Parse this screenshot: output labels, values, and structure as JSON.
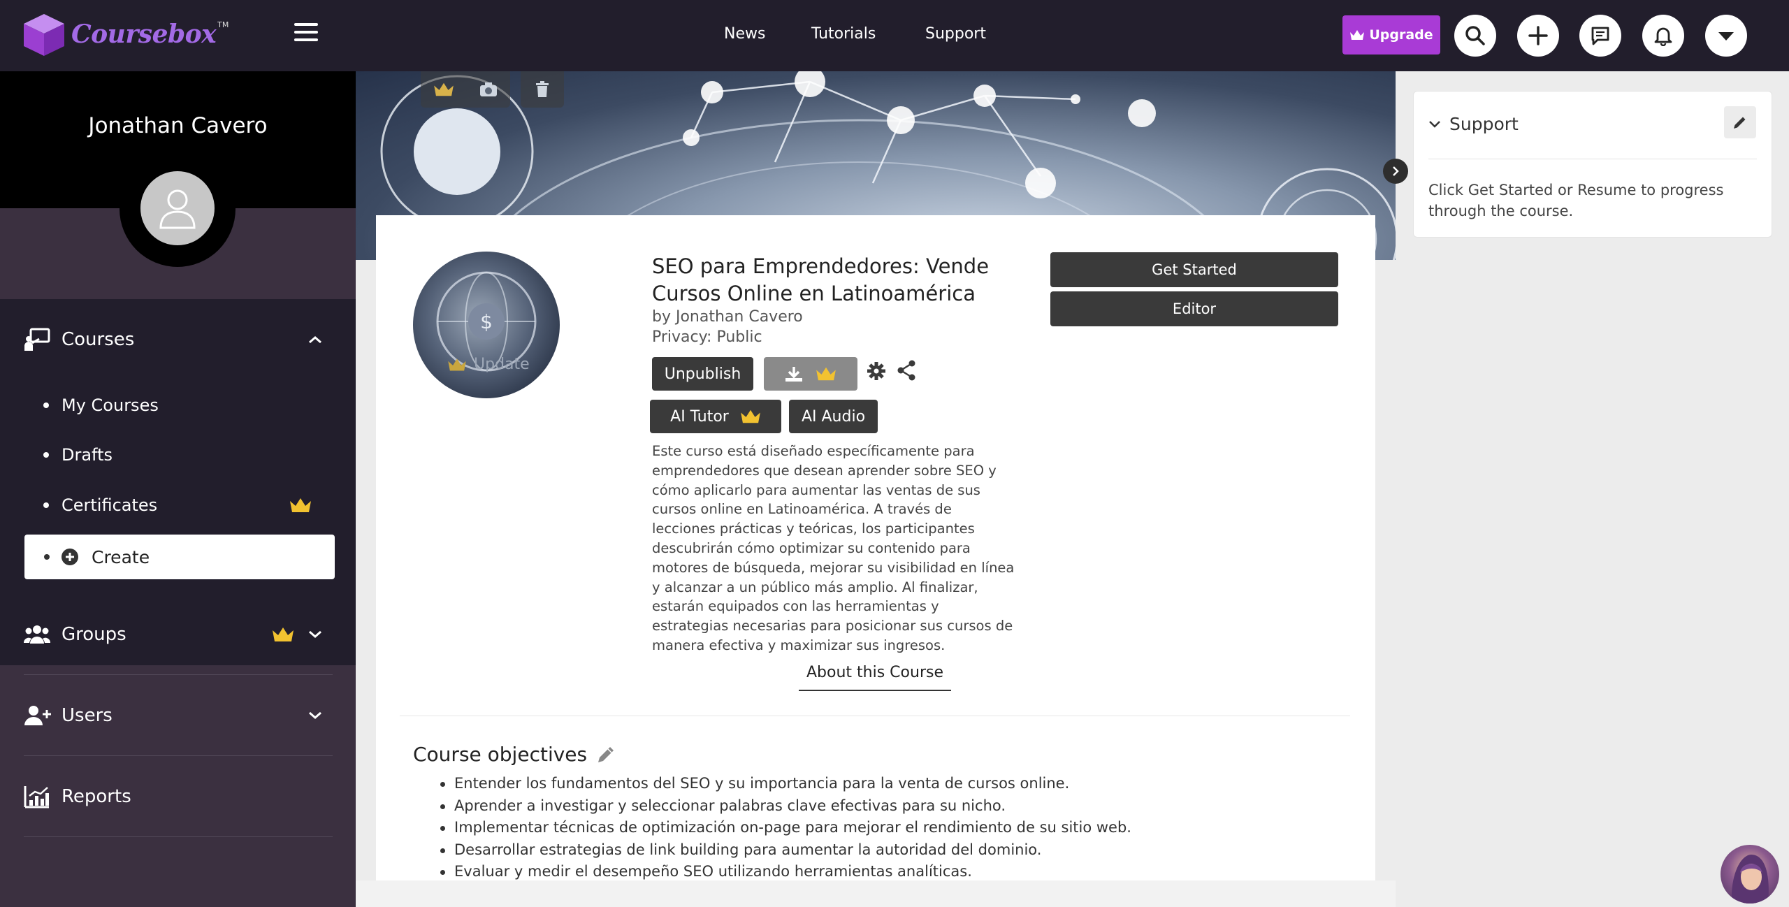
{
  "app": {
    "logo_text": "Coursebox",
    "logo_tm": "TM"
  },
  "topnav": {
    "news": "News",
    "tutorials": "Tutorials",
    "support": "Support",
    "upgrade": "Upgrade"
  },
  "sidebar": {
    "user_name": "Jonathan Cavero",
    "courses": {
      "label": "Courses",
      "items": [
        "My Courses",
        "Drafts",
        "Certificates"
      ],
      "create": "Create"
    },
    "groups": "Groups",
    "users": "Users",
    "reports": "Reports"
  },
  "course": {
    "title": "SEO para Emprendedores: Vende Cursos Online en Latinoamérica",
    "by": "by Jonathan Cavero",
    "privacy": "Privacy: Public",
    "thumb_update": "Update",
    "unpublish": "Unpublish",
    "ai_tutor": "AI Tutor",
    "ai_audio": "AI Audio",
    "get_started": "Get Started",
    "editor": "Editor",
    "description": "Este curso está diseñado específicamente para emprendedores que desean aprender sobre SEO y cómo aplicarlo para aumentar las ventas de sus cursos online en Latinoamérica. A través de lecciones prácticas y teóricas, los participantes descubrirán cómo optimizar su contenido para motores de búsqueda, mejorar su visibilidad en línea y alcanzar a un público más amplio. Al finalizar, estarán equipados con las herramientas y estrategias necesarias para posicionar sus cursos de manera efectiva y maximizar sus ingresos.",
    "about_tab": "About this Course",
    "objectives_title": "Course objectives",
    "objectives": [
      "Entender los fundamentos del SEO y su importancia para la venta de cursos online.",
      "Aprender a investigar y seleccionar palabras clave efectivas para su nicho.",
      "Implementar técnicas de optimización on-page para mejorar el rendimiento de su sitio web.",
      "Desarrollar estrategias de link building para aumentar la autoridad del dominio.",
      "Evaluar y medir el desempeño SEO utilizando herramientas analíticas."
    ]
  },
  "support_panel": {
    "title": "Support",
    "text": "Click Get Started or Resume to progress through the course."
  },
  "colors": {
    "topbar": "#221e2c",
    "accent": "#a93bd6",
    "crown": "#f2c230"
  }
}
